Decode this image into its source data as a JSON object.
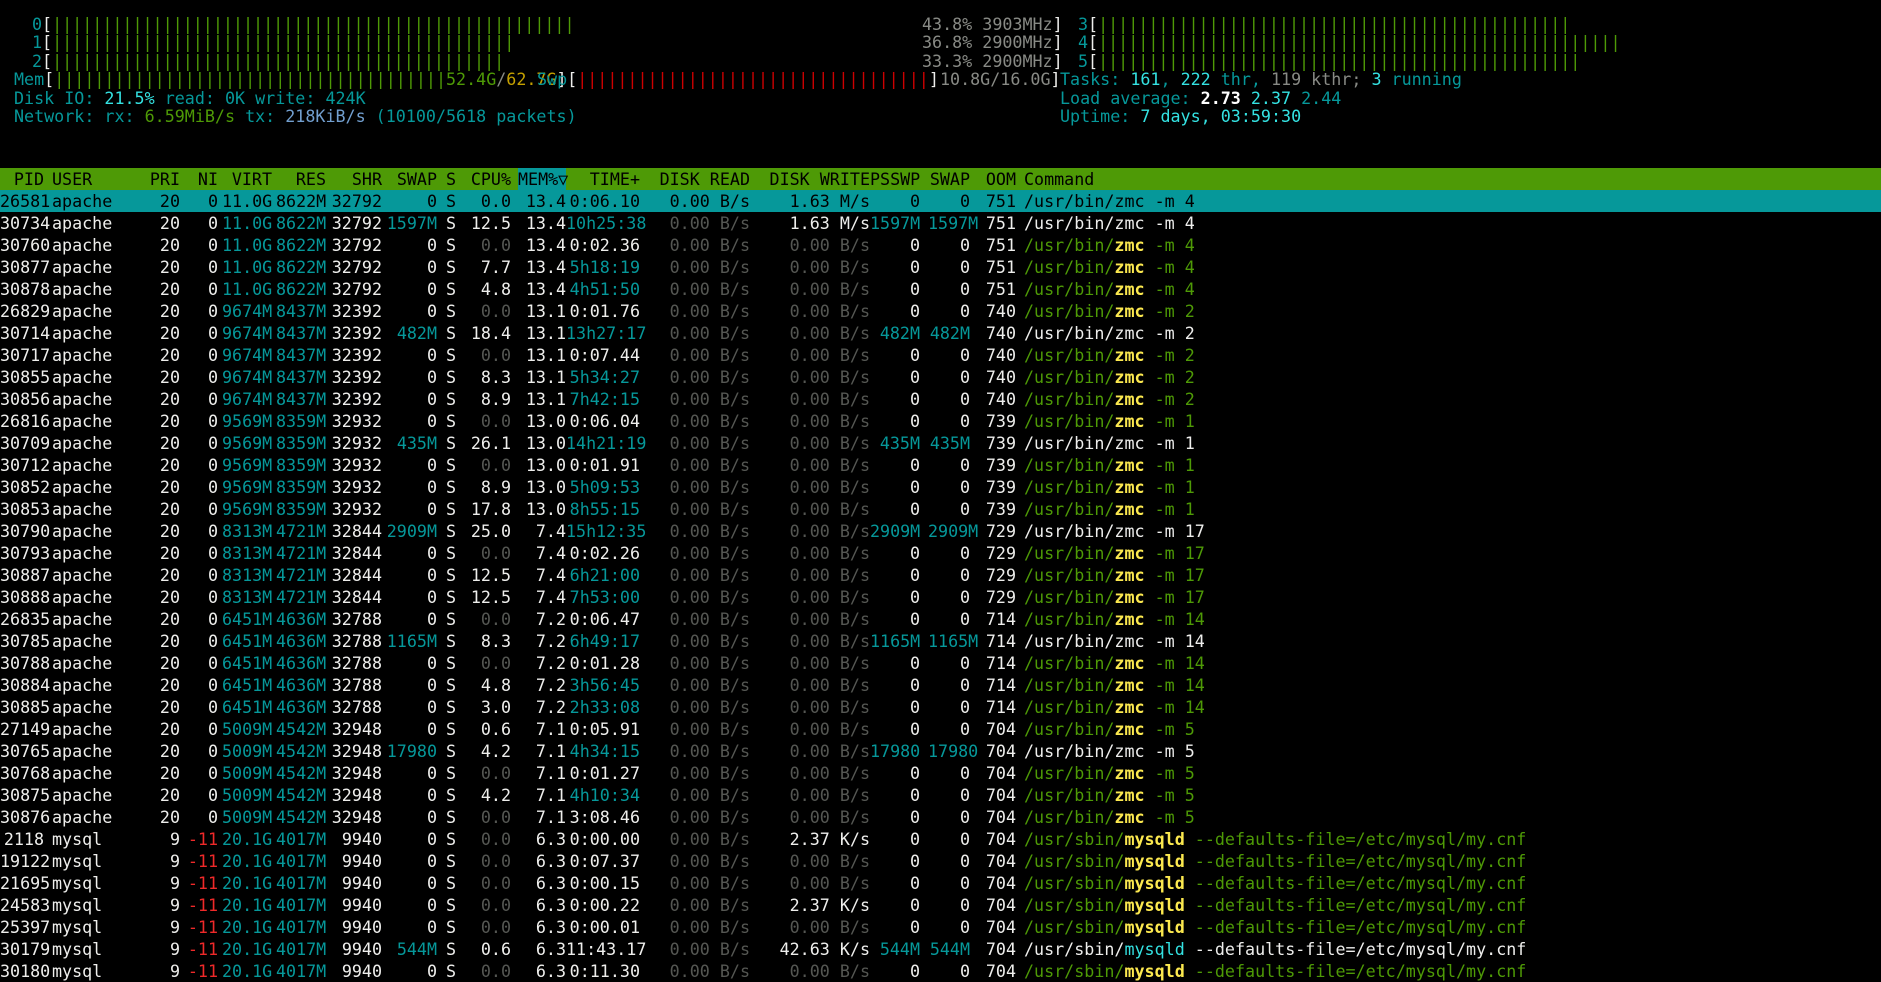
{
  "meters": {
    "cpus": [
      {
        "label": "0",
        "bar": "||||||||||||||||||||||||||||||||||||||||||||||||||||",
        "pct": "43.8%",
        "freq": "3903MHz"
      },
      {
        "label": "1",
        "bar": "||||||||||||||||||||||||||||||||||||||||||||||",
        "pct": "36.8%",
        "freq": "2900MHz"
      },
      {
        "label": "2",
        "bar": "|||||||||||||||||||||||||||||||||||||||||||||",
        "pct": "33.3%",
        "freq": "2900MHz"
      },
      {
        "label": "3",
        "bar": "|||||||||||||||||||||||||||||||||||||||||||||||"
      },
      {
        "label": "4",
        "bar": "||||||||||||||||||||||||||||||||||||||||||||||||||||"
      },
      {
        "label": "5",
        "bar": "||||||||||||||||||||||||||||||||||||||||||||||||"
      }
    ],
    "mem": {
      "label": "Mem",
      "used": "52.4G",
      "total": "62.7G"
    },
    "swp": {
      "label": "Swp",
      "value": "10.8G/16.0G"
    },
    "disk_io": {
      "label": "Disk IO:",
      "pct": "21.5%",
      "read_label": "read:",
      "read": "0K",
      "write_label": "write:",
      "write": "424K"
    },
    "network": {
      "label": "Network:",
      "rx_label": "rx:",
      "rx": "6.59MiB/s",
      "tx_label": "tx:",
      "tx": "218KiB/s",
      "packets": "(10100/5618 packets)"
    },
    "tasks": {
      "label": "Tasks:",
      "tasks": "161",
      "thr": "222",
      "thr_label": "thr,",
      "kthr": "119",
      "kthr_label": "kthr;",
      "running": "3",
      "running_label": "running"
    },
    "load": {
      "label": "Load average:",
      "l1": "2.73",
      "l5": "2.37",
      "l15": "2.44"
    },
    "uptime": {
      "label": "Uptime:",
      "value": "7 days, 03:59:30"
    }
  },
  "columns": [
    "PID",
    "USER",
    "PRI",
    "NI",
    "VIRT",
    "RES",
    "SHR",
    "SWAP",
    "S",
    "CPU%",
    "MEM%▽",
    "TIME+",
    "DISK READ",
    "DISK WRITE",
    "PSSWP",
    "SWAP",
    "OOM",
    "Command"
  ],
  "processes": [
    [
      "26581",
      "apache",
      "20",
      "0",
      "11.0G",
      "8622M",
      "32792",
      "0",
      "S",
      "0.0",
      "13.4",
      "0:06.10",
      "0.00 B/s",
      "1.63 M/s",
      "0",
      "0",
      "751",
      "/usr/bin/",
      "zmc",
      " -m 4"
    ],
    [
      "30734",
      "apache",
      "20",
      "0",
      "11.0G",
      "8622M",
      "32792",
      "1597M",
      "S",
      "12.5",
      "13.4",
      "10h25:38",
      "0.00 B/s",
      "1.63 M/s",
      "1597M",
      "1597M",
      "751",
      "/usr/bin/",
      "zmc",
      " -m 4"
    ],
    [
      "30760",
      "apache",
      "20",
      "0",
      "11.0G",
      "8622M",
      "32792",
      "0",
      "S",
      "0.0",
      "13.4",
      "0:02.36",
      "0.00 B/s",
      "0.00 B/s",
      "0",
      "0",
      "751",
      "/usr/bin/",
      "zmc",
      " -m 4"
    ],
    [
      "30877",
      "apache",
      "20",
      "0",
      "11.0G",
      "8622M",
      "32792",
      "0",
      "S",
      "7.7",
      "13.4",
      "5h18:19",
      "0.00 B/s",
      "0.00 B/s",
      "0",
      "0",
      "751",
      "/usr/bin/",
      "zmc",
      " -m 4"
    ],
    [
      "30878",
      "apache",
      "20",
      "0",
      "11.0G",
      "8622M",
      "32792",
      "0",
      "S",
      "4.8",
      "13.4",
      "4h51:50",
      "0.00 B/s",
      "0.00 B/s",
      "0",
      "0",
      "751",
      "/usr/bin/",
      "zmc",
      " -m 4"
    ],
    [
      "26829",
      "apache",
      "20",
      "0",
      "9674M",
      "8437M",
      "32392",
      "0",
      "S",
      "0.0",
      "13.1",
      "0:01.76",
      "0.00 B/s",
      "0.00 B/s",
      "0",
      "0",
      "740",
      "/usr/bin/",
      "zmc",
      " -m 2"
    ],
    [
      "30714",
      "apache",
      "20",
      "0",
      "9674M",
      "8437M",
      "32392",
      "482M",
      "S",
      "18.4",
      "13.1",
      "13h27:17",
      "0.00 B/s",
      "0.00 B/s",
      "482M",
      "482M",
      "740",
      "/usr/bin/",
      "zmc",
      " -m 2"
    ],
    [
      "30717",
      "apache",
      "20",
      "0",
      "9674M",
      "8437M",
      "32392",
      "0",
      "S",
      "0.0",
      "13.1",
      "0:07.44",
      "0.00 B/s",
      "0.00 B/s",
      "0",
      "0",
      "740",
      "/usr/bin/",
      "zmc",
      " -m 2"
    ],
    [
      "30855",
      "apache",
      "20",
      "0",
      "9674M",
      "8437M",
      "32392",
      "0",
      "S",
      "8.3",
      "13.1",
      "5h34:27",
      "0.00 B/s",
      "0.00 B/s",
      "0",
      "0",
      "740",
      "/usr/bin/",
      "zmc",
      " -m 2"
    ],
    [
      "30856",
      "apache",
      "20",
      "0",
      "9674M",
      "8437M",
      "32392",
      "0",
      "S",
      "8.9",
      "13.1",
      "7h42:15",
      "0.00 B/s",
      "0.00 B/s",
      "0",
      "0",
      "740",
      "/usr/bin/",
      "zmc",
      " -m 2"
    ],
    [
      "26816",
      "apache",
      "20",
      "0",
      "9569M",
      "8359M",
      "32932",
      "0",
      "S",
      "0.0",
      "13.0",
      "0:06.04",
      "0.00 B/s",
      "0.00 B/s",
      "0",
      "0",
      "739",
      "/usr/bin/",
      "zmc",
      " -m 1"
    ],
    [
      "30709",
      "apache",
      "20",
      "0",
      "9569M",
      "8359M",
      "32932",
      "435M",
      "S",
      "26.1",
      "13.0",
      "14h21:19",
      "0.00 B/s",
      "0.00 B/s",
      "435M",
      "435M",
      "739",
      "/usr/bin/",
      "zmc",
      " -m 1"
    ],
    [
      "30712",
      "apache",
      "20",
      "0",
      "9569M",
      "8359M",
      "32932",
      "0",
      "S",
      "0.0",
      "13.0",
      "0:01.91",
      "0.00 B/s",
      "0.00 B/s",
      "0",
      "0",
      "739",
      "/usr/bin/",
      "zmc",
      " -m 1"
    ],
    [
      "30852",
      "apache",
      "20",
      "0",
      "9569M",
      "8359M",
      "32932",
      "0",
      "S",
      "8.9",
      "13.0",
      "5h09:53",
      "0.00 B/s",
      "0.00 B/s",
      "0",
      "0",
      "739",
      "/usr/bin/",
      "zmc",
      " -m 1"
    ],
    [
      "30853",
      "apache",
      "20",
      "0",
      "9569M",
      "8359M",
      "32932",
      "0",
      "S",
      "17.8",
      "13.0",
      "8h55:15",
      "0.00 B/s",
      "0.00 B/s",
      "0",
      "0",
      "739",
      "/usr/bin/",
      "zmc",
      " -m 1"
    ],
    [
      "30790",
      "apache",
      "20",
      "0",
      "8313M",
      "4721M",
      "32844",
      "2909M",
      "S",
      "25.0",
      "7.4",
      "15h12:35",
      "0.00 B/s",
      "0.00 B/s",
      "2909M",
      "2909M",
      "729",
      "/usr/bin/",
      "zmc",
      " -m 17"
    ],
    [
      "30793",
      "apache",
      "20",
      "0",
      "8313M",
      "4721M",
      "32844",
      "0",
      "S",
      "0.0",
      "7.4",
      "0:02.26",
      "0.00 B/s",
      "0.00 B/s",
      "0",
      "0",
      "729",
      "/usr/bin/",
      "zmc",
      " -m 17"
    ],
    [
      "30887",
      "apache",
      "20",
      "0",
      "8313M",
      "4721M",
      "32844",
      "0",
      "S",
      "12.5",
      "7.4",
      "6h21:00",
      "0.00 B/s",
      "0.00 B/s",
      "0",
      "0",
      "729",
      "/usr/bin/",
      "zmc",
      " -m 17"
    ],
    [
      "30888",
      "apache",
      "20",
      "0",
      "8313M",
      "4721M",
      "32844",
      "0",
      "S",
      "12.5",
      "7.4",
      "7h53:00",
      "0.00 B/s",
      "0.00 B/s",
      "0",
      "0",
      "729",
      "/usr/bin/",
      "zmc",
      " -m 17"
    ],
    [
      "26835",
      "apache",
      "20",
      "0",
      "6451M",
      "4636M",
      "32788",
      "0",
      "S",
      "0.0",
      "7.2",
      "0:06.47",
      "0.00 B/s",
      "0.00 B/s",
      "0",
      "0",
      "714",
      "/usr/bin/",
      "zmc",
      " -m 14"
    ],
    [
      "30785",
      "apache",
      "20",
      "0",
      "6451M",
      "4636M",
      "32788",
      "1165M",
      "S",
      "8.3",
      "7.2",
      "6h49:17",
      "0.00 B/s",
      "0.00 B/s",
      "1165M",
      "1165M",
      "714",
      "/usr/bin/",
      "zmc",
      " -m 14"
    ],
    [
      "30788",
      "apache",
      "20",
      "0",
      "6451M",
      "4636M",
      "32788",
      "0",
      "S",
      "0.0",
      "7.2",
      "0:01.28",
      "0.00 B/s",
      "0.00 B/s",
      "0",
      "0",
      "714",
      "/usr/bin/",
      "zmc",
      " -m 14"
    ],
    [
      "30884",
      "apache",
      "20",
      "0",
      "6451M",
      "4636M",
      "32788",
      "0",
      "S",
      "4.8",
      "7.2",
      "3h56:45",
      "0.00 B/s",
      "0.00 B/s",
      "0",
      "0",
      "714",
      "/usr/bin/",
      "zmc",
      " -m 14"
    ],
    [
      "30885",
      "apache",
      "20",
      "0",
      "6451M",
      "4636M",
      "32788",
      "0",
      "S",
      "3.0",
      "7.2",
      "2h33:08",
      "0.00 B/s",
      "0.00 B/s",
      "0",
      "0",
      "714",
      "/usr/bin/",
      "zmc",
      " -m 14"
    ],
    [
      "27149",
      "apache",
      "20",
      "0",
      "5009M",
      "4542M",
      "32948",
      "0",
      "S",
      "0.6",
      "7.1",
      "0:05.91",
      "0.00 B/s",
      "0.00 B/s",
      "0",
      "0",
      "704",
      "/usr/bin/",
      "zmc",
      " -m 5"
    ],
    [
      "30765",
      "apache",
      "20",
      "0",
      "5009M",
      "4542M",
      "32948",
      "17980",
      "S",
      "4.2",
      "7.1",
      "4h34:15",
      "0.00 B/s",
      "0.00 B/s",
      "17980",
      "17980",
      "704",
      "/usr/bin/",
      "zmc",
      " -m 5"
    ],
    [
      "30768",
      "apache",
      "20",
      "0",
      "5009M",
      "4542M",
      "32948",
      "0",
      "S",
      "0.0",
      "7.1",
      "0:01.27",
      "0.00 B/s",
      "0.00 B/s",
      "0",
      "0",
      "704",
      "/usr/bin/",
      "zmc",
      " -m 5"
    ],
    [
      "30875",
      "apache",
      "20",
      "0",
      "5009M",
      "4542M",
      "32948",
      "0",
      "S",
      "4.2",
      "7.1",
      "4h10:34",
      "0.00 B/s",
      "0.00 B/s",
      "0",
      "0",
      "704",
      "/usr/bin/",
      "zmc",
      " -m 5"
    ],
    [
      "30876",
      "apache",
      "20",
      "0",
      "5009M",
      "4542M",
      "32948",
      "0",
      "S",
      "0.0",
      "7.1",
      "3:08.46",
      "0.00 B/s",
      "0.00 B/s",
      "0",
      "0",
      "704",
      "/usr/bin/",
      "zmc",
      " -m 5"
    ],
    [
      "2118",
      "mysql",
      "9",
      "-11",
      "20.1G",
      "4017M",
      "9940",
      "0",
      "S",
      "0.0",
      "6.3",
      "0:00.00",
      "0.00 B/s",
      "2.37 K/s",
      "0",
      "0",
      "704",
      "/usr/sbin/",
      "mysqld",
      " --defaults-file=/etc/mysql/my.cnf"
    ],
    [
      "19122",
      "mysql",
      "9",
      "-11",
      "20.1G",
      "4017M",
      "9940",
      "0",
      "S",
      "0.0",
      "6.3",
      "0:07.37",
      "0.00 B/s",
      "0.00 B/s",
      "0",
      "0",
      "704",
      "/usr/sbin/",
      "mysqld",
      " --defaults-file=/etc/mysql/my.cnf"
    ],
    [
      "21695",
      "mysql",
      "9",
      "-11",
      "20.1G",
      "4017M",
      "9940",
      "0",
      "S",
      "0.0",
      "6.3",
      "0:00.15",
      "0.00 B/s",
      "0.00 B/s",
      "0",
      "0",
      "704",
      "/usr/sbin/",
      "mysqld",
      " --defaults-file=/etc/mysql/my.cnf"
    ],
    [
      "24583",
      "mysql",
      "9",
      "-11",
      "20.1G",
      "4017M",
      "9940",
      "0",
      "S",
      "0.0",
      "6.3",
      "0:00.22",
      "0.00 B/s",
      "2.37 K/s",
      "0",
      "0",
      "704",
      "/usr/sbin/",
      "mysqld",
      " --defaults-file=/etc/mysql/my.cnf"
    ],
    [
      "25397",
      "mysql",
      "9",
      "-11",
      "20.1G",
      "4017M",
      "9940",
      "0",
      "S",
      "0.0",
      "6.3",
      "0:00.01",
      "0.00 B/s",
      "0.00 B/s",
      "0",
      "0",
      "704",
      "/usr/sbin/",
      "mysqld",
      " --defaults-file=/etc/mysql/my.cnf"
    ],
    [
      "30179",
      "mysql",
      "9",
      "-11",
      "20.1G",
      "4017M",
      "9940",
      "544M",
      "S",
      "0.6",
      "6.3",
      "11:43.17",
      "0.00 B/s",
      "42.63 K/s",
      "544M",
      "544M",
      "704",
      "/usr/sbin/",
      "mysqld",
      " --defaults-file=/etc/mysql/my.cnf"
    ],
    [
      "30180",
      "mysql",
      "9",
      "-11",
      "20.1G",
      "4017M",
      "9940",
      "0",
      "S",
      "0.0",
      "6.3",
      "0:11.30",
      "0.00 B/s",
      "0.00 B/s",
      "0",
      "0",
      "704",
      "/usr/sbin/",
      "mysqld",
      " --defaults-file=/etc/mysql/my.cnf"
    ]
  ],
  "colors": {
    "header_bg": "#4e9a06",
    "selected_bg": "#06989a",
    "accent_cyan": "#34e2e2"
  }
}
